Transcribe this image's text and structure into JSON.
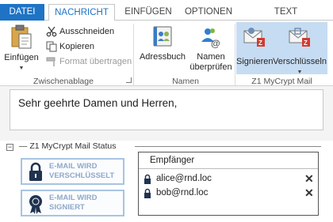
{
  "tabs": {
    "file": "DATEI",
    "message": "NACHRICHT",
    "insert": "EINFÜGEN",
    "options": "OPTIONEN",
    "format": "TEXT FORMATIEREN"
  },
  "ribbon": {
    "clipboard": {
      "paste": "Einfügen",
      "cut": "Ausschneiden",
      "copy": "Kopieren",
      "format_painter": "Format übertragen",
      "label": "Zwischenablage"
    },
    "names": {
      "address_book": "Adressbuch",
      "check_names_1": "Namen",
      "check_names_2": "überprüfen",
      "label": "Namen"
    },
    "mycrypt": {
      "sign": "Signieren",
      "encrypt": "Verschlüsseln",
      "label": "Z1 MyCrypt Mail"
    }
  },
  "message": {
    "body": "Sehr geehrte Damen und Herren,"
  },
  "status": {
    "heading": "Z1 MyCrypt Mail Status",
    "collapse_symbol": "−",
    "encrypted_1": "E-MAIL WIRD",
    "encrypted_2": "VERSCHLÜSSELT",
    "signed_1": "E-MAIL WIRD",
    "signed_2": "SIGNIERT"
  },
  "recipients": {
    "header": "Empfänger",
    "list": [
      "alice@rnd.loc",
      "bob@rnd.loc"
    ],
    "remove_symbol": "✕"
  },
  "colors": {
    "accent": "#1e73c5",
    "highlight": "#c6dcf2",
    "status_text": "#8ea9c9"
  }
}
